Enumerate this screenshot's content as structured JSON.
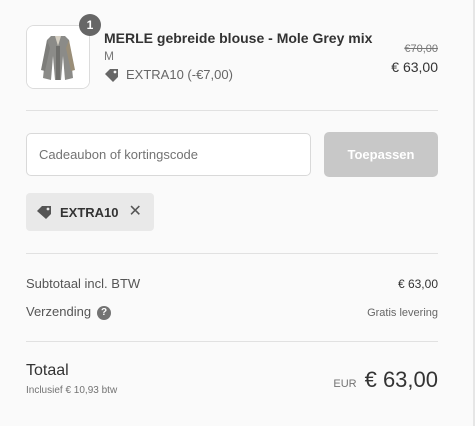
{
  "product": {
    "quantity": "1",
    "title": "MERLE gebreide blouse - Mole Grey mix",
    "variant": "M",
    "discount_label": "EXTRA10 (-€7,00)",
    "original_price": "€70,00",
    "price": "€ 63,00",
    "image_icon": "cardigan-thumbnail"
  },
  "discount_form": {
    "placeholder": "Cadeaubon of kortingscode",
    "apply_label": "Toepassen"
  },
  "applied_code": {
    "code": "EXTRA10",
    "remove_icon": "close-icon"
  },
  "summary": {
    "subtotal_label": "Subtotaal incl. BTW",
    "subtotal_value": "€ 63,00",
    "shipping_label": "Verzending",
    "shipping_value": "Gratis levering",
    "help_icon": "?"
  },
  "total": {
    "label": "Totaal",
    "tax_note": "Inclusief € 10,93 btw",
    "currency": "EUR",
    "value": "€ 63,00"
  },
  "colors": {
    "background": "#fafafa",
    "button_disabled": "#c8c8c8",
    "badge": "#666666"
  }
}
